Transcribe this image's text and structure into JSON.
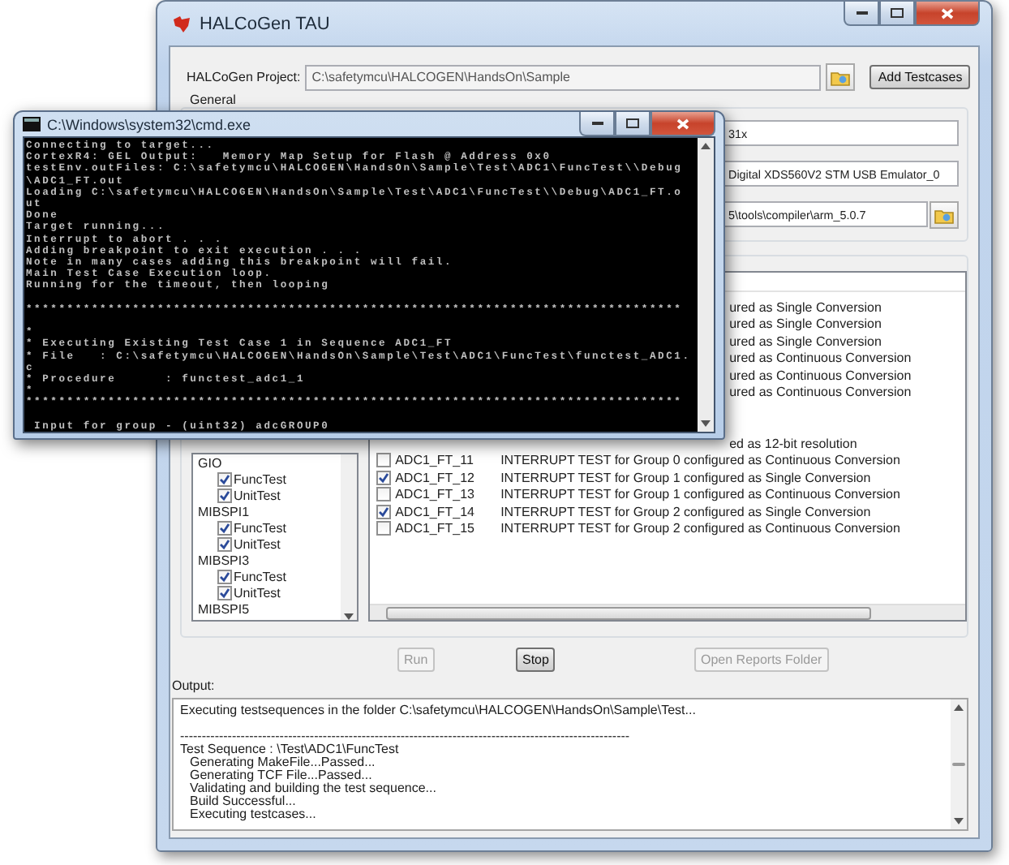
{
  "main_window": {
    "title": "HALCoGen TAU",
    "project": {
      "label": "HALCoGen Project:",
      "value": "C:\\safetymcu\\HALCOGEN\\HandsOn\\Sample"
    },
    "add_button": "Add Testcases",
    "general": {
      "title": "General",
      "fields": [
        {
          "kind": "text",
          "value": "31x"
        },
        {
          "kind": "text",
          "value": "Digital XDS560V2 STM USB Emulator_0"
        },
        {
          "kind": "browse",
          "value": "5\\tools\\compiler\\arm_5.0.7"
        }
      ]
    },
    "tree": [
      {
        "label": "GIO",
        "children": [
          {
            "label": "FuncTest",
            "checked": true
          },
          {
            "label": "UnitTest",
            "checked": true
          }
        ]
      },
      {
        "label": "MIBSPI1",
        "children": [
          {
            "label": "FuncTest",
            "checked": true
          },
          {
            "label": "UnitTest",
            "checked": true
          }
        ]
      },
      {
        "label": "MIBSPI3",
        "children": [
          {
            "label": "FuncTest",
            "checked": true
          },
          {
            "label": "UnitTest",
            "checked": true
          }
        ]
      },
      {
        "label": "MIBSPI5"
      }
    ],
    "testcases": [
      {
        "kind": "partial",
        "description": "ured as Single Conversion"
      },
      {
        "kind": "partial",
        "description": "ured as Single Conversion"
      },
      {
        "kind": "partial",
        "description": "ured as Single Conversion"
      },
      {
        "kind": "partial",
        "description": "ured as Continuous Conversion"
      },
      {
        "kind": "partial",
        "description": "ured as Continuous Conversion"
      },
      {
        "kind": "partial",
        "description": "ured as Continuous Conversion"
      },
      {
        "kind": "partial",
        "description": "ed as 12-bit resolution",
        "gap_before": true
      },
      {
        "kind": "full",
        "checked": false,
        "name": "ADC1_FT_11",
        "description": "INTERRUPT TEST for Group 0 configured as Continuous Conversion"
      },
      {
        "kind": "full",
        "checked": true,
        "name": "ADC1_FT_12",
        "description": "INTERRUPT TEST for Group 1 configured as Single Conversion"
      },
      {
        "kind": "full",
        "checked": false,
        "name": "ADC1_FT_13",
        "description": "INTERRUPT TEST for Group 1 configured as Continuous Conversion"
      },
      {
        "kind": "full",
        "checked": true,
        "name": "ADC1_FT_14",
        "description": "INTERRUPT TEST for Group 2 configured as Single Conversion"
      },
      {
        "kind": "full",
        "checked": false,
        "name": "ADC1_FT_15",
        "description": "INTERRUPT TEST for Group 2 configured as Continuous Conversion"
      }
    ],
    "buttons": [
      {
        "label": "Run",
        "disabled": true
      },
      {
        "label": "Stop",
        "disabled": false
      },
      {
        "label": "Open Reports Folder",
        "disabled": true
      }
    ],
    "output": {
      "label": "Output:",
      "lines": [
        {
          "text": "Executing testsequences in the folder C:\\safetymcu\\HALCOGEN\\HandsOn\\Sample\\Test..."
        },
        {
          "text": "--------------------------------------------------------------------------------------------------------",
          "space_before": true
        },
        {
          "text": "Test Sequence : \\Test\\ADC1\\FuncTest",
          "children": [
            {
              "text": "Generating MakeFile...Passed..."
            },
            {
              "text": "Generating TCF File...Passed..."
            },
            {
              "text": "Validating and building the test sequence..."
            },
            {
              "text": "Build Successful..."
            },
            {
              "text": "Executing testcases..."
            }
          ]
        }
      ]
    }
  },
  "console": {
    "title": "C:\\Windows\\system32\\cmd.exe",
    "lines": [
      {
        "text": "Connecting to target..."
      },
      {
        "text": "CortexR4: GEL Output:   Memory Map Setup for Flash @ Address 0x0"
      },
      {
        "text": "testEnv.outFiles: C:\\safetymcu\\HALCOGEN\\HandsOn\\Sample\\Test\\ADC1\\FuncTest\\\\Debug"
      },
      {
        "text": "\\ADC1_FT.out"
      },
      {
        "text": "Loading C:\\safetymcu\\HALCOGEN\\HandsOn\\Sample\\Test\\ADC1\\FuncTest\\\\Debug\\ADC1_FT.o"
      },
      {
        "text": "ut"
      },
      {
        "text": "Done"
      },
      {
        "text": "Target running..."
      },
      {
        "text": "Interrupt to abort . . ."
      },
      {
        "text": "Adding breakpoint to exit execution . . ."
      },
      {
        "text": "Note in many cases adding this breakpoint will fail."
      },
      {
        "text": "Main Test Case Execution loop."
      },
      {
        "text": "Running for the timeout, then looping"
      },
      {
        "text": "********************************************************************************",
        "space_before": true
      },
      {
        "text": "*",
        "space_before": true
      },
      {
        "text": "* Executing Existing Test Case 1 in Sequence ADC1_FT"
      },
      {
        "text": "* File   : C:\\safetymcu\\HALCOGEN\\HandsOn\\Sample\\Test\\ADC1\\FuncTest\\functest_ADC1."
      },
      {
        "text": "c"
      },
      {
        "text": "* Procedure      : functest_adc1_1"
      },
      {
        "text": "*"
      },
      {
        "text": "********************************************************************************"
      },
      {
        "text": " Input for group - (uint32) adcGROUP0",
        "space_before": true
      }
    ]
  }
}
